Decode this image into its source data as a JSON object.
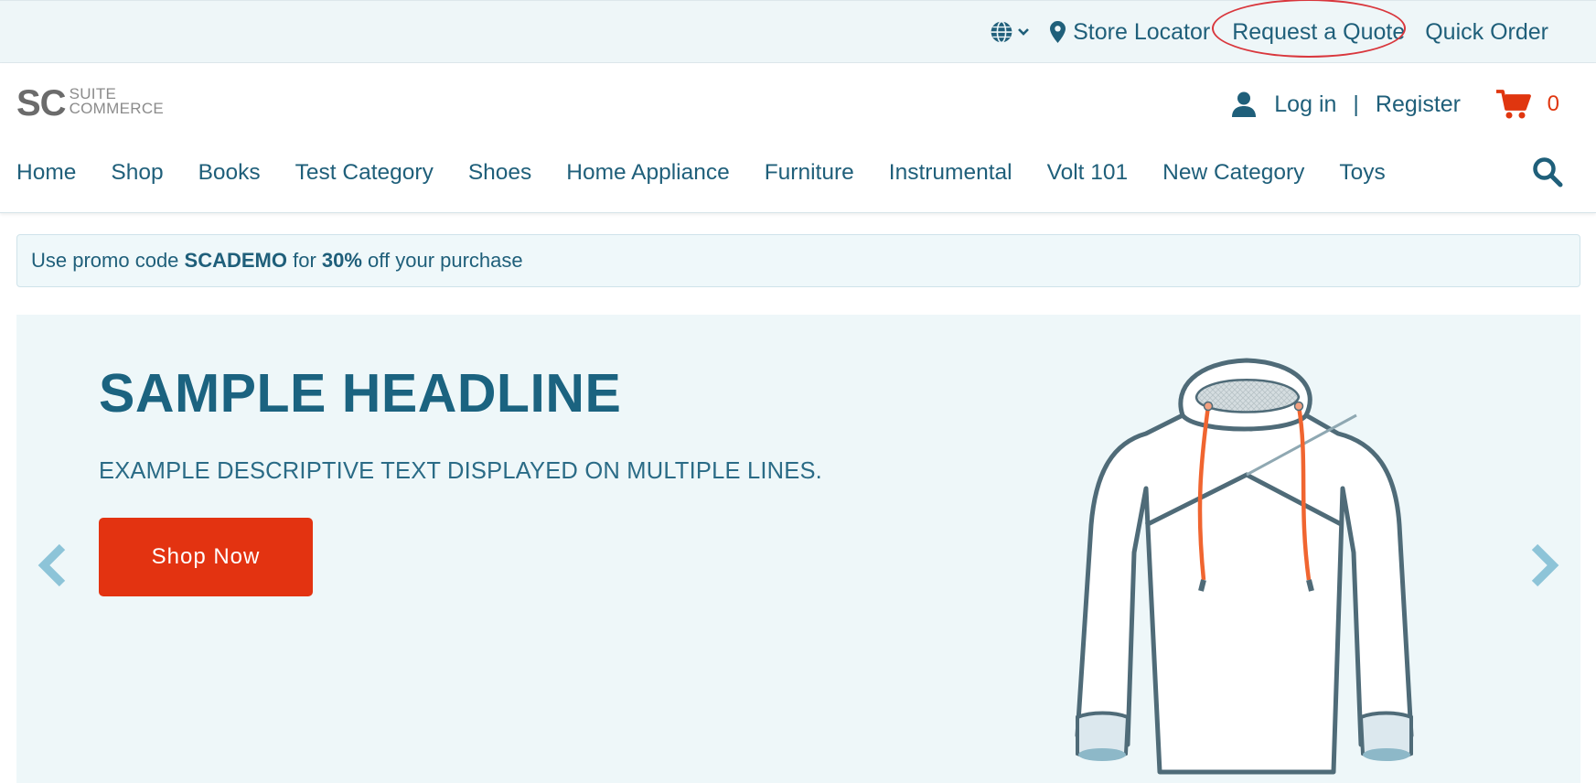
{
  "topbar": {
    "store_locator": "Store Locator",
    "request_quote": "Request a Quote",
    "quick_order": "Quick Order"
  },
  "logo": {
    "mark": "SC",
    "line1": "SUITE",
    "line2": "COMMERCE"
  },
  "account": {
    "login": "Log in",
    "separator": "|",
    "register": "Register"
  },
  "cart": {
    "count": "0"
  },
  "nav": {
    "items": [
      "Home",
      "Shop",
      "Books",
      "Test Category",
      "Shoes",
      "Home Appliance",
      "Furniture",
      "Instrumental",
      "Volt 101",
      "New Category",
      "Toys"
    ]
  },
  "promo": {
    "prefix": "Use promo code ",
    "code": "SCADEMO",
    "middle": " for ",
    "discount": "30%",
    "suffix": " off your purchase"
  },
  "hero": {
    "headline": "SAMPLE HEADLINE",
    "subtext": "EXAMPLE DESCRIPTIVE TEXT DISPLAYED ON MULTIPLE LINES.",
    "cta": "Shop Now"
  },
  "icons": {
    "language": "globe-icon",
    "store": "map-pin-icon",
    "user": "user-icon",
    "cart": "cart-icon",
    "search": "search-icon",
    "prev": "chevron-left-icon",
    "next": "chevron-right-icon"
  },
  "colors": {
    "primary": "#1f5f7a",
    "accent": "#e33311",
    "highlight_ring": "#d9373d",
    "topbar_bg": "#eef6f8",
    "hero_bg": "#eef7f9"
  }
}
